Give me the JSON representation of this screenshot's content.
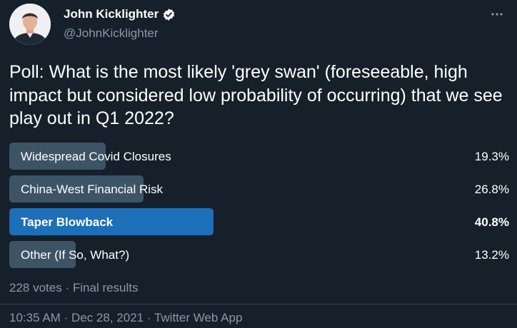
{
  "author": {
    "name": "John Kicklighter",
    "handle": "@JohnKicklighter",
    "verified_icon": "verified-badge-icon",
    "avatar": "profile-photo"
  },
  "tweet": {
    "text": "Poll: What is the most likely 'grey swan' (foreseeable, high impact but considered low probability of occurring) that we see play out in Q1 2022?"
  },
  "poll": {
    "options": [
      {
        "label": "Widespread Covid Closures",
        "percent_text": "19.3%",
        "percent": 19.3,
        "winner": false
      },
      {
        "label": "China-West Financial Risk",
        "percent_text": "26.8%",
        "percent": 26.8,
        "winner": false
      },
      {
        "label": "Taper Blowback",
        "percent_text": "40.8%",
        "percent": 40.8,
        "winner": true
      },
      {
        "label": "Other (If So, What?)",
        "percent_text": "13.2%",
        "percent": 13.2,
        "winner": false
      }
    ],
    "votes": "228 votes",
    "separator": "·",
    "status": "Final results"
  },
  "footer": {
    "time": "10:35 AM",
    "date": "Dec 28, 2021",
    "separator": "·",
    "source": "Twitter Web App"
  },
  "colors": {
    "background": "#15202b",
    "bar": "#3d5466",
    "bar_winner": "#1d6fb8",
    "secondary_text": "#8b98a5",
    "verified": "#ffffff"
  }
}
